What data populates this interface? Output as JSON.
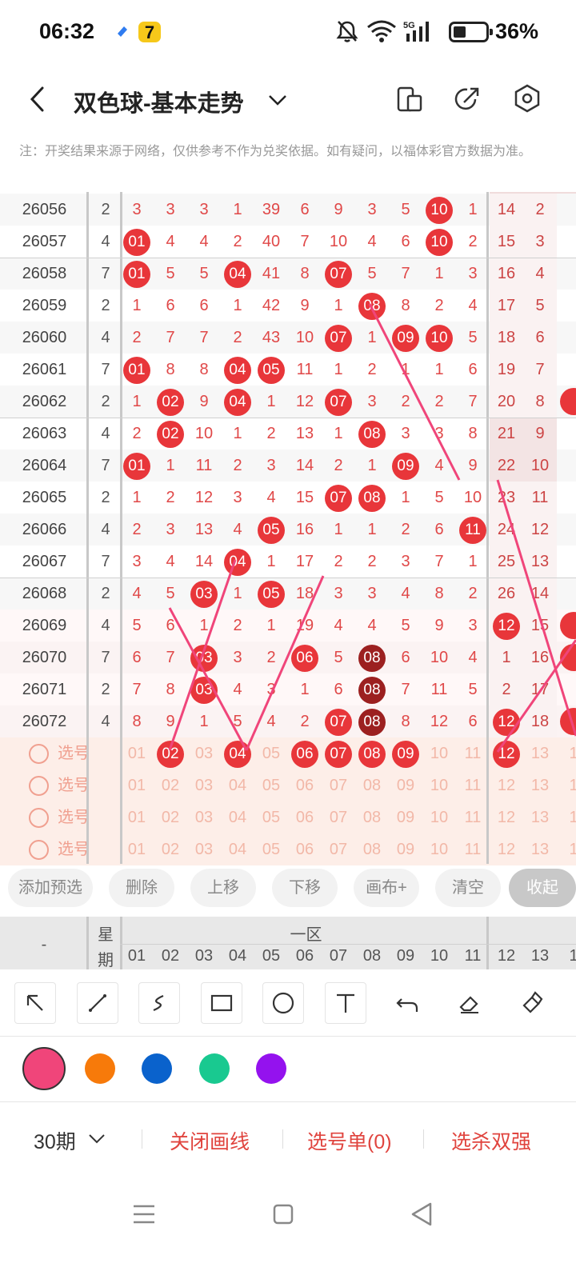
{
  "status_bar": {
    "time": "06:32",
    "battery": "36%",
    "battery_level": 0.36
  },
  "header": {
    "title": "双色球-基本走势"
  },
  "note": "注：开奖结果来源于网络，仅供参考不作为兑奖依据。如有疑问，以福体彩官方数据为准。",
  "columns": [
    "01",
    "02",
    "03",
    "04",
    "05",
    "06",
    "07",
    "08",
    "09",
    "10",
    "11",
    "12",
    "13",
    "1"
  ],
  "rows": [
    {
      "period": "26056",
      "week": "2",
      "cells": [
        "3",
        "3",
        "3",
        "1",
        "39",
        "6",
        "9",
        "3",
        "5",
        "10",
        "1",
        "14",
        "2"
      ],
      "balls": [
        9
      ]
    },
    {
      "period": "26057",
      "week": "4",
      "cells": [
        "01",
        "4",
        "4",
        "2",
        "40",
        "7",
        "10",
        "4",
        "6",
        "10",
        "2",
        "15",
        "3"
      ],
      "balls": [
        0,
        9
      ]
    },
    {
      "period": "26058",
      "week": "7",
      "cells": [
        "01",
        "5",
        "5",
        "04",
        "41",
        "8",
        "07",
        "5",
        "7",
        "1",
        "3",
        "16",
        "4"
      ],
      "balls": [
        0,
        3,
        6
      ]
    },
    {
      "period": "26059",
      "week": "2",
      "cells": [
        "1",
        "6",
        "6",
        "1",
        "42",
        "9",
        "1",
        "08",
        "8",
        "2",
        "4",
        "17",
        "5"
      ],
      "balls": [
        7
      ]
    },
    {
      "period": "26060",
      "week": "4",
      "cells": [
        "2",
        "7",
        "7",
        "2",
        "43",
        "10",
        "07",
        "1",
        "09",
        "10",
        "5",
        "18",
        "6"
      ],
      "balls": [
        6,
        8,
        9
      ]
    },
    {
      "period": "26061",
      "week": "7",
      "cells": [
        "01",
        "8",
        "8",
        "04",
        "05",
        "11",
        "1",
        "2",
        "1",
        "1",
        "6",
        "19",
        "7"
      ],
      "balls": [
        0,
        3,
        4
      ]
    },
    {
      "period": "26062",
      "week": "2",
      "cells": [
        "1",
        "02",
        "9",
        "04",
        "1",
        "12",
        "07",
        "3",
        "2",
        "2",
        "7",
        "20",
        "8"
      ],
      "balls": [
        1,
        3,
        6
      ]
    },
    {
      "period": "26063",
      "week": "4",
      "cells": [
        "2",
        "02",
        "10",
        "1",
        "2",
        "13",
        "1",
        "08",
        "3",
        "3",
        "8",
        "21",
        "9"
      ],
      "balls": [
        1,
        7
      ]
    },
    {
      "period": "26064",
      "week": "7",
      "cells": [
        "01",
        "1",
        "11",
        "2",
        "3",
        "14",
        "2",
        "1",
        "09",
        "4",
        "9",
        "22",
        "10"
      ],
      "balls": [
        0,
        8
      ]
    },
    {
      "period": "26065",
      "week": "2",
      "cells": [
        "1",
        "2",
        "12",
        "3",
        "4",
        "15",
        "07",
        "08",
        "1",
        "5",
        "10",
        "23",
        "11"
      ],
      "balls": [
        6,
        7
      ]
    },
    {
      "period": "26066",
      "week": "4",
      "cells": [
        "2",
        "3",
        "13",
        "4",
        "05",
        "16",
        "1",
        "1",
        "2",
        "6",
        "11",
        "24",
        "12"
      ],
      "balls": [
        4,
        10
      ]
    },
    {
      "period": "26067",
      "week": "7",
      "cells": [
        "3",
        "4",
        "14",
        "04",
        "1",
        "17",
        "2",
        "2",
        "3",
        "7",
        "1",
        "25",
        "13"
      ],
      "balls": [
        3
      ]
    },
    {
      "period": "26068",
      "week": "2",
      "cells": [
        "4",
        "5",
        "03",
        "1",
        "05",
        "18",
        "3",
        "3",
        "4",
        "8",
        "2",
        "26",
        "14"
      ],
      "balls": [
        2,
        4
      ]
    },
    {
      "period": "26069",
      "week": "4",
      "cells": [
        "5",
        "6",
        "1",
        "2",
        "1",
        "19",
        "4",
        "4",
        "5",
        "9",
        "3",
        "12",
        "15"
      ],
      "balls": [
        11
      ]
    },
    {
      "period": "26070",
      "week": "7",
      "cells": [
        "6",
        "7",
        "03",
        "3",
        "2",
        "06",
        "5",
        "08",
        "6",
        "10",
        "4",
        "1",
        "16"
      ],
      "balls": [
        2,
        5,
        7
      ],
      "dark": [
        7
      ]
    },
    {
      "period": "26071",
      "week": "2",
      "cells": [
        "7",
        "8",
        "03",
        "4",
        "3",
        "1",
        "6",
        "08",
        "7",
        "11",
        "5",
        "2",
        "17"
      ],
      "balls": [
        2,
        7
      ],
      "dark": [
        7
      ]
    },
    {
      "period": "26072",
      "week": "4",
      "cells": [
        "8",
        "9",
        "1",
        "5",
        "4",
        "2",
        "07",
        "08",
        "8",
        "12",
        "6",
        "12",
        "18"
      ],
      "balls": [
        6,
        7,
        11
      ],
      "dark": [
        7
      ]
    }
  ],
  "select_rows": [
    {
      "label": "选号",
      "picked": [
        1,
        3,
        5,
        6,
        7,
        8,
        11
      ]
    },
    {
      "label": "选号",
      "picked": []
    },
    {
      "label": "选号",
      "picked": []
    },
    {
      "label": "选号",
      "picked": []
    }
  ],
  "select_nums": [
    "01",
    "02",
    "03",
    "04",
    "05",
    "06",
    "07",
    "08",
    "09",
    "10",
    "11",
    "12",
    "13",
    "1"
  ],
  "toolbar": {
    "buttons": [
      "添加预选",
      "删除",
      "上移",
      "下移",
      "画布+",
      "清空",
      "收起"
    ]
  },
  "col_header": {
    "dash": "-",
    "week_top": "星",
    "week_bottom": "期",
    "zone": "一区"
  },
  "draw_tools": [
    "arrow-tool",
    "line-tool",
    "curve-tool",
    "rect-tool",
    "circle-tool",
    "text-tool",
    "undo-tool",
    "eraser-tool",
    "clear-tool"
  ],
  "colors": [
    "#f0457a",
    "#f77a0a",
    "#0a62cc",
    "#19c990",
    "#9412ee"
  ],
  "bottom": {
    "periods": "30期",
    "close_draw": "关闭画线",
    "select_list": "选号单(0)",
    "kill": "选杀双强"
  }
}
